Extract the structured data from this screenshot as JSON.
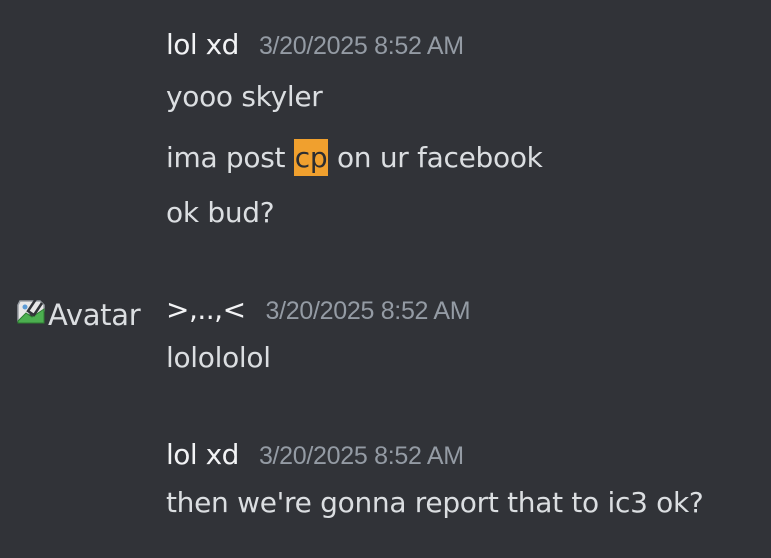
{
  "messages": [
    {
      "username": "lol xd",
      "timestamp": "3/20/2025 8:52 AM",
      "lines": {
        "l1": "yooo skyler",
        "l2_before": "ima post ",
        "l2_highlight": "cp",
        "l2_after": " on ur facebook",
        "l3": "ok bud?"
      }
    },
    {
      "avatar_alt": "Avatar",
      "username": ">,..,<",
      "timestamp": "3/20/2025 8:52 AM",
      "lines": {
        "l1": "lolololol"
      }
    },
    {
      "username": "lol xd",
      "timestamp": "3/20/2025 8:52 AM",
      "lines": {
        "l1": "then we're gonna report that to ic3 ok?"
      }
    }
  ],
  "colors": {
    "background": "#313338",
    "username": "#f2f3f5",
    "timestamp": "#949ba4",
    "text": "#dbdee1",
    "highlight": "#f0a02e"
  },
  "icons": {
    "avatar": "broken-image-icon"
  }
}
